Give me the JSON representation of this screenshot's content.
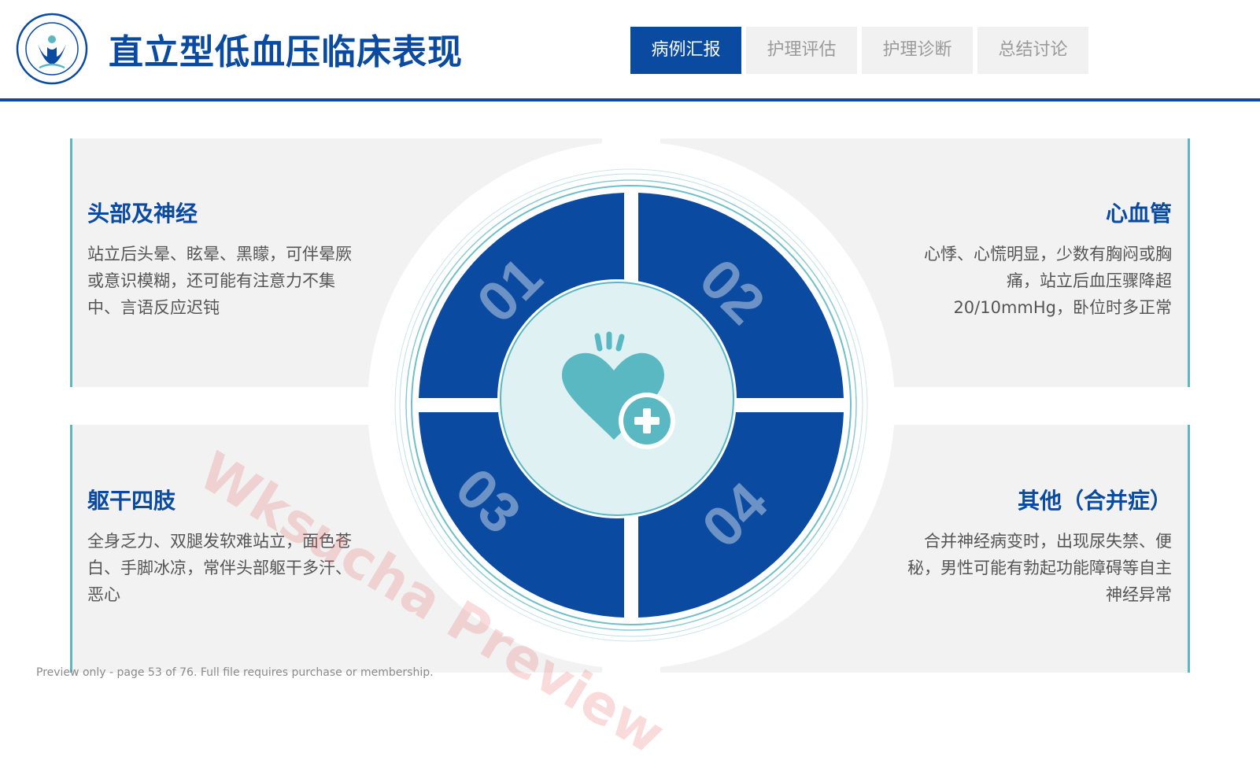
{
  "header": {
    "title": "直立型低血压临床表现",
    "tabs": [
      {
        "label": "病例汇报",
        "active": true
      },
      {
        "label": "护理评估",
        "active": false
      },
      {
        "label": "护理诊断",
        "active": false
      },
      {
        "label": "总结讨论",
        "active": false
      }
    ]
  },
  "sections": {
    "top_left": {
      "title": "头部及神经",
      "text": "站立后头晕、眩晕、黑矇，可伴晕厥或意识模糊，还可能有注意力不集中、言语反应迟钝"
    },
    "top_right": {
      "title": "心血管",
      "text": "心悸、心慌明显，少数有胸闷或胸痛，站立后血压骤降超20/10mmHg，卧位时多正常"
    },
    "bottom_left": {
      "title": "躯干四肢",
      "text": "全身乏力、双腿发软难站立，面色苍白、手脚冰凉，常伴头部躯干多汗、恶心"
    },
    "bottom_right": {
      "title": "其他（合并症）",
      "text": "合并神经病变时，出现尿失禁、便秘，男性可能有勃起功能障碍等自主神经异常"
    }
  },
  "diagram": {
    "numbers": [
      "01",
      "02",
      "03",
      "04"
    ],
    "center_icon": "heart-plus-icon"
  },
  "watermark": "Wksucha Preview",
  "footer": "Preview only - page 53 of 76. Full file requires purchase or membership.",
  "colors": {
    "primary": "#0a4aa0",
    "accent": "#5ab8c3",
    "panel": "#f2f2f2"
  }
}
